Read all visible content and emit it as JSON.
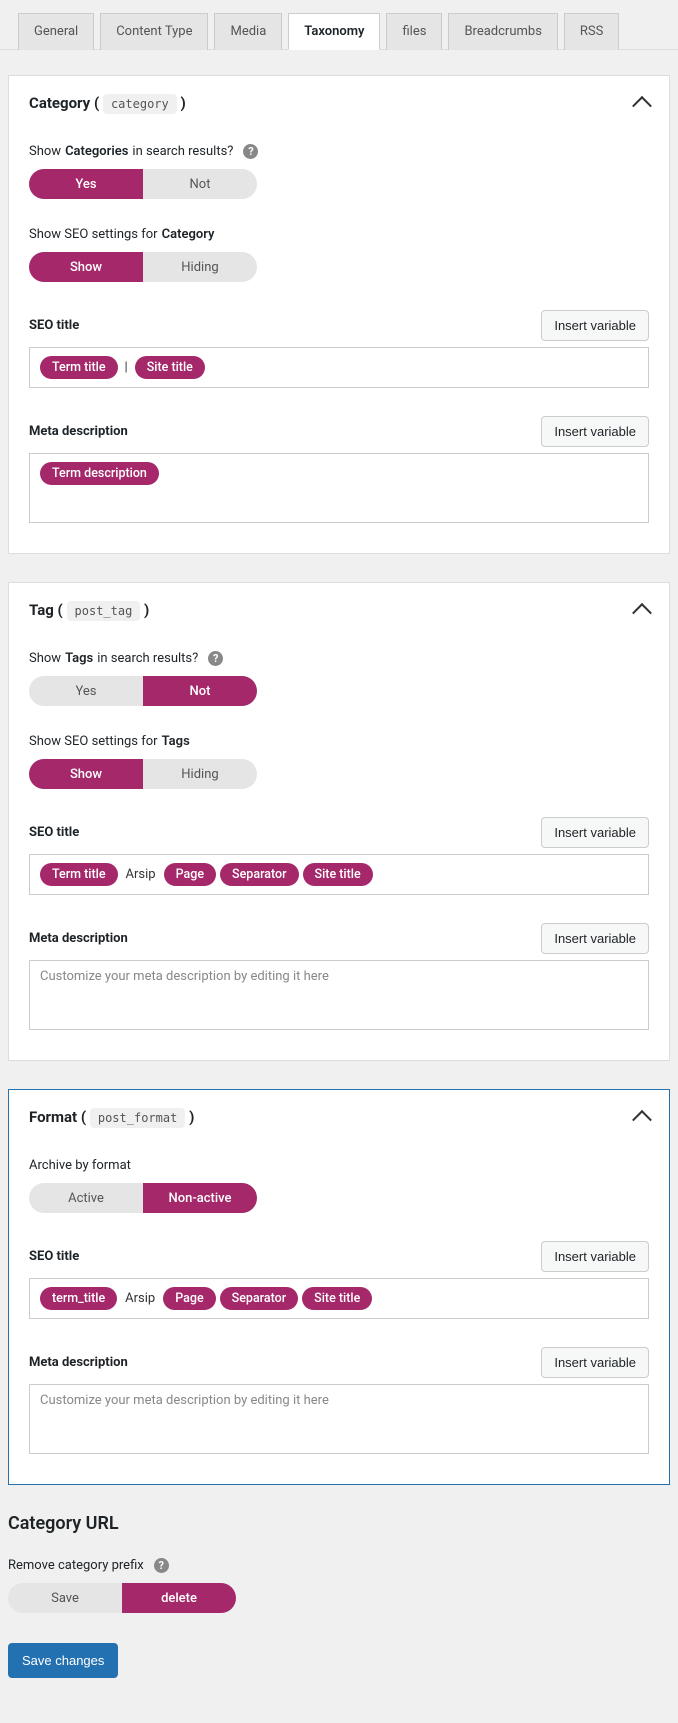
{
  "tabs": [
    "General",
    "Content Type",
    "Media",
    "Taxonomy",
    "files",
    "Breadcrumbs",
    "RSS"
  ],
  "cat": {
    "title_a": "Category",
    "title_code": "category",
    "q1_a": "Show",
    "q1_b": "Categories",
    "q1_c": "in search results?",
    "yes": "Yes",
    "not": "Not",
    "q2_a": "Show SEO settings for",
    "q2_b": "Category",
    "show": "Show",
    "hiding": "Hiding",
    "seo_label": "SEO title",
    "insert": "Insert variable",
    "p_term": "Term title",
    "p_site": "Site title",
    "sep_char": "|",
    "meta_label": "Meta description",
    "p_termdesc": "Term description"
  },
  "tag": {
    "title_a": "Tag",
    "title_code": "post_tag",
    "q1_a": "Show",
    "q1_b": "Tags",
    "q1_c": "in search results?",
    "yes": "Yes",
    "not": "Not",
    "q2_a": "Show SEO settings for",
    "q2_b": "Tags",
    "show": "Show",
    "hiding": "Hiding",
    "seo_label": "SEO title",
    "insert": "Insert variable",
    "p_term": "Term title",
    "txt_arsip": "Arsip",
    "p_page": "Page",
    "p_sep": "Separator",
    "p_site": "Site title",
    "meta_label": "Meta description",
    "meta_placeholder": "Customize your meta description by editing it here"
  },
  "fmt": {
    "title_a": "Format",
    "title_code": "post_format",
    "q1": "Archive by format",
    "active": "Active",
    "nonactive": "Non-active",
    "seo_label": "SEO title",
    "insert": "Insert variable",
    "p_term": "term_title",
    "txt_arsip": "Arsip",
    "p_page": "Page",
    "p_sep": "Separator",
    "p_site": "Site title",
    "meta_label": "Meta description",
    "meta_placeholder": "Customize your meta description by editing it here"
  },
  "url": {
    "heading": "Category URL",
    "remove": "Remove category prefix",
    "save": "Save",
    "delete": "delete"
  },
  "save_changes": "Save changes"
}
